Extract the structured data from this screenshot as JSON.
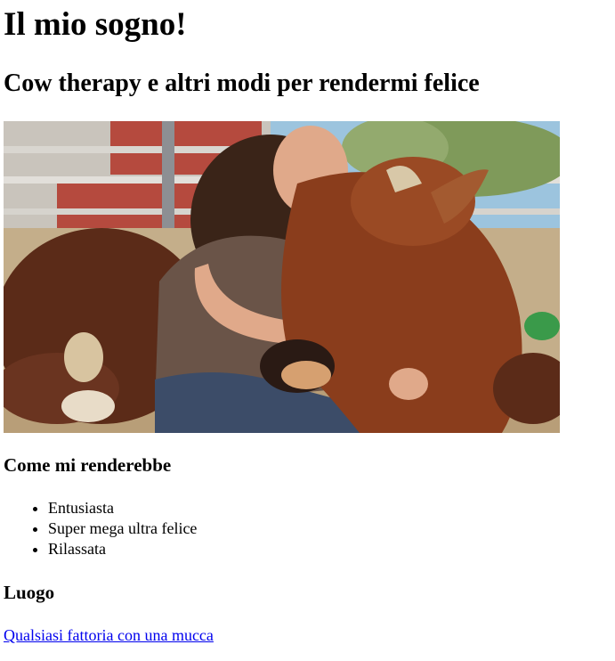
{
  "page": {
    "title": "Il mio sogno!",
    "subtitle": "Cow therapy e altri modi per rendermi felice"
  },
  "photo": {
    "alt": "Donna che abbraccia una mucca sdraiata"
  },
  "feelings": {
    "heading": "Come mi renderebbe",
    "items": [
      "Entusiasta",
      "Super mega ultra felice",
      "Rilassata"
    ]
  },
  "place": {
    "heading": "Luogo",
    "link_text": "Qualsiasi fattoria con una mucca"
  },
  "colors": {
    "link": "#0000ee",
    "text": "#000000",
    "background": "#ffffff"
  }
}
